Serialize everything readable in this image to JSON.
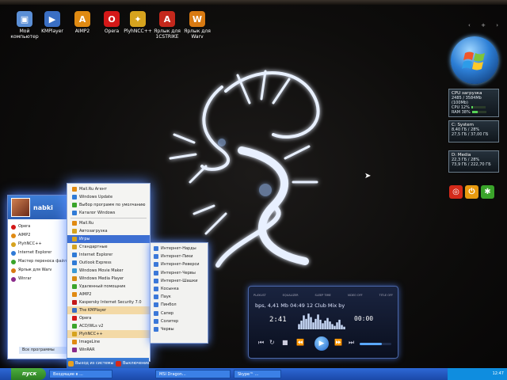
{
  "desktop": {
    "icons": [
      {
        "label": "Мой компьютер",
        "glyph": "▣",
        "color": "#5b8fd6"
      },
      {
        "label": "KMPlayer",
        "glyph": "▶",
        "color": "#3a6fc4"
      },
      {
        "label": "AIMP2",
        "glyph": "A",
        "color": "#e08a12"
      },
      {
        "label": "Opera",
        "glyph": "O",
        "color": "#d41818"
      },
      {
        "label": "PlyhNCC++",
        "glyph": "✦",
        "color": "#d6a31e"
      },
      {
        "label": "Ярлык для 1CSTRIKE",
        "glyph": "A",
        "color": "#c4281c"
      },
      {
        "label": "Ярлык для Warv",
        "glyph": "W",
        "color": "#d87a12"
      }
    ]
  },
  "sidebar": {
    "arrows": [
      "‹",
      "+",
      "›"
    ],
    "cpu_title": "CPU загрузка",
    "cpu_lines": [
      "2485 / 3584Mb (100Mb)",
      "CPU   12%",
      "RAM   38%"
    ],
    "drive_c": {
      "title": "C: System",
      "lines": [
        "8,40 ГБ / 28%",
        "27,5 ГБ / 37,00 ГБ"
      ]
    },
    "drive_d": {
      "title": "D: Media",
      "lines": [
        "22,3 ГБ / 28%",
        "73,9 ГБ / 222,70 ГБ"
      ]
    },
    "buttons": [
      {
        "glyph": "◎",
        "color": "#d42a1a"
      },
      {
        "glyph": "⏻",
        "color": "#e89a10"
      },
      {
        "glyph": "✱",
        "color": "#3aa42a"
      }
    ]
  },
  "start_menu": {
    "user": "nabki",
    "items": [
      {
        "label": "Opera",
        "color": "#d41818"
      },
      {
        "label": "AIMP2",
        "color": "#e08a12"
      },
      {
        "label": "PlyhNCC++",
        "color": "#d6a31e"
      },
      {
        "label": "Internet Explorer",
        "color": "#2f7ad6"
      },
      {
        "label": "Мастер переноса файлов",
        "color": "#3aa42a"
      },
      {
        "label": "Ярлык для Warv",
        "color": "#d87a12"
      },
      {
        "label": "Winrar",
        "color": "#8a2a8a"
      }
    ],
    "all_programs": "Все программы"
  },
  "programs_menu": {
    "items": [
      {
        "label": "Mail.Ru Агент",
        "color": "#e08a12",
        "style": ""
      },
      {
        "label": "Windows Update",
        "color": "#2f7ad6",
        "style": ""
      },
      {
        "label": "Выбор программ по умолчанию",
        "color": "#3aa42a",
        "style": ""
      },
      {
        "label": "Каталог Windows",
        "color": "#2f7ad6",
        "style": ""
      },
      {
        "label": "",
        "color": "",
        "style": "sep"
      },
      {
        "label": "Mail.Ru",
        "color": "#e08a12",
        "style": ""
      },
      {
        "label": "Автозагрузка",
        "color": "#d6a31e",
        "style": ""
      },
      {
        "label": "Игры",
        "color": "#d6a31e",
        "style": "hl"
      },
      {
        "label": "Стандартные",
        "color": "#d6a31e",
        "style": ""
      },
      {
        "label": "Internet Explorer",
        "color": "#2f7ad6",
        "style": ""
      },
      {
        "label": "Outlook Express",
        "color": "#2f7ad6",
        "style": ""
      },
      {
        "label": "Windows Movie Maker",
        "color": "#3b9ad6",
        "style": ""
      },
      {
        "label": "Windows Media Player",
        "color": "#d68a12",
        "style": ""
      },
      {
        "label": "Удаленный помощник",
        "color": "#3aa42a",
        "style": ""
      },
      {
        "label": "AIMP2",
        "color": "#e08a12",
        "style": ""
      },
      {
        "label": "Kaspersky Internet Security 7.0",
        "color": "#c41818",
        "style": ""
      },
      {
        "label": "The KMPlayer",
        "color": "#3a6fc4",
        "style": "hl2"
      },
      {
        "label": "Opera",
        "color": "#d41818",
        "style": ""
      },
      {
        "label": "ACD/WLs v2",
        "color": "#3aa42a",
        "style": ""
      },
      {
        "label": "PlyhNCC++",
        "color": "#d6a31e",
        "style": "hl2"
      },
      {
        "label": "ImageLine",
        "color": "#e08a12",
        "style": ""
      },
      {
        "label": "WinRAR",
        "color": "#8a2a8a",
        "style": ""
      }
    ]
  },
  "games_submenu": {
    "items": [
      "Интернет-Нарды",
      "Интернет-Пики",
      "Интернет-Реверси",
      "Интернет-Червы",
      "Интернет-Шашки",
      "Косынка",
      "Паук",
      "Пинбол",
      "Сапер",
      "Солитер",
      "Червы"
    ]
  },
  "logoff": {
    "logoff_label": "Выход из системы",
    "shutdown_label": "Выключение"
  },
  "taskbar": {
    "start_label": "пуск",
    "tasks": [
      "Входящие в ...",
      "MSI Dragon...",
      "Skype™ ..."
    ],
    "clock": "12:47"
  },
  "player": {
    "tabs": [
      "PLAYLIST",
      "EQUALIZER",
      "SLEEP TIME",
      "VIDEO OFF",
      "TITLE OFF"
    ],
    "track_info": "bps, 4,41 Mb   04:49   12 Club Mix by",
    "time": "2:41",
    "frame": "00:00",
    "viz_levels": [
      0.3,
      0.5,
      0.8,
      0.6,
      0.9,
      0.7,
      0.4,
      0.6,
      0.85,
      0.55,
      0.35,
      0.5,
      0.65,
      0.45,
      0.3,
      0.2,
      0.4,
      0.55,
      0.25,
      0.15
    ]
  }
}
